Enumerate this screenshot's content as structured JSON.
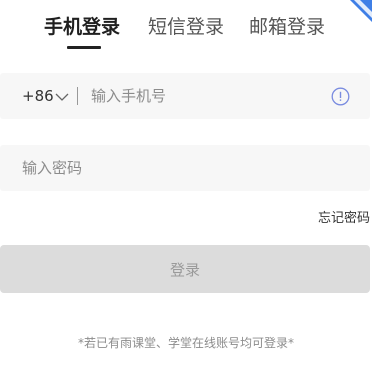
{
  "tabs": [
    {
      "label": "手机登录",
      "active": true
    },
    {
      "label": "短信登录",
      "active": false
    },
    {
      "label": "邮箱登录",
      "active": false
    }
  ],
  "phone": {
    "country_code": "+86",
    "placeholder": "输入手机号",
    "value": "",
    "info_icon": "info-circle-icon"
  },
  "password": {
    "placeholder": "输入密码",
    "value": ""
  },
  "forgot_password": "忘记密码",
  "login_button": "登录",
  "footnote": "*若已有雨课堂、学堂在线账号均可登录*",
  "colors": {
    "field_bg": "#f7f7f7",
    "button_bg": "#dcdcdc",
    "button_text": "#9a9a9a",
    "info_icon": "#7a8ce0",
    "active_tab": "#1f1f1f"
  }
}
